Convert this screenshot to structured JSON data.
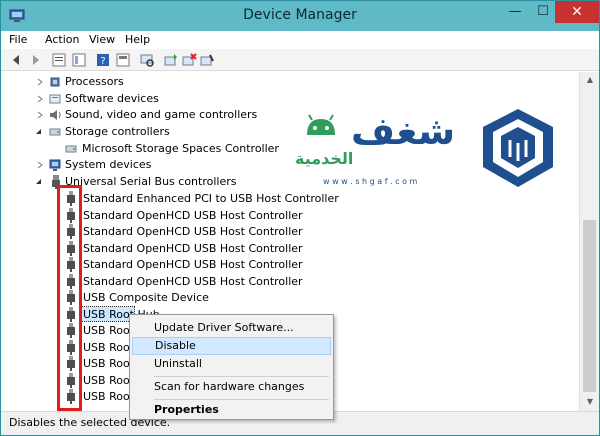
{
  "window": {
    "title": "Device Manager",
    "minimize": "—",
    "maximize": "☐",
    "close": "✕"
  },
  "menu": [
    "File",
    "Action",
    "View",
    "Help"
  ],
  "tree": {
    "categories": [
      {
        "label": "Processors",
        "expanded": false
      },
      {
        "label": "Software devices",
        "expanded": false
      },
      {
        "label": "Sound, video and game controllers",
        "expanded": false
      },
      {
        "label": "Storage controllers",
        "expanded": true
      },
      {
        "label": "Microsoft Storage Spaces Controller",
        "child": true
      },
      {
        "label": "System devices",
        "expanded": false
      },
      {
        "label": "Universal Serial Bus controllers",
        "expanded": true
      }
    ],
    "usb_devices": [
      "Standard Enhanced PCI to USB Host Controller",
      "Standard OpenHCD USB Host Controller",
      "Standard OpenHCD USB Host Controller",
      "Standard OpenHCD USB Host Controller",
      "Standard OpenHCD USB Host Controller",
      "Standard OpenHCD USB Host Controller",
      "USB Composite Device",
      "USB Root Hub",
      "USB Roo",
      "USB Roo",
      "USB Roo",
      "USB Roo",
      "USB Roo"
    ],
    "selected_index": 7
  },
  "context_menu": {
    "items": [
      {
        "label": "Update Driver Software...",
        "hover": false,
        "bold": false
      },
      {
        "label": "Disable",
        "hover": true,
        "bold": false
      },
      {
        "label": "Uninstall",
        "hover": false,
        "bold": false
      },
      {
        "label": "Scan for hardware changes",
        "hover": false,
        "bold": false
      },
      {
        "label": "Properties",
        "hover": false,
        "bold": true
      }
    ]
  },
  "status": {
    "text": "Disables the selected device."
  },
  "watermark": {
    "arabic_main": "شغف",
    "arabic_sub": "الخدمية",
    "url": "w w w . s h g a f . c o m"
  },
  "colors": {
    "titlebar": "#5fb9c6",
    "highlight": "#e21b1b",
    "menu_hover": "#d1e8ff",
    "watermark_blue": "#1f4f8f",
    "watermark_green": "#2f9e5b"
  }
}
